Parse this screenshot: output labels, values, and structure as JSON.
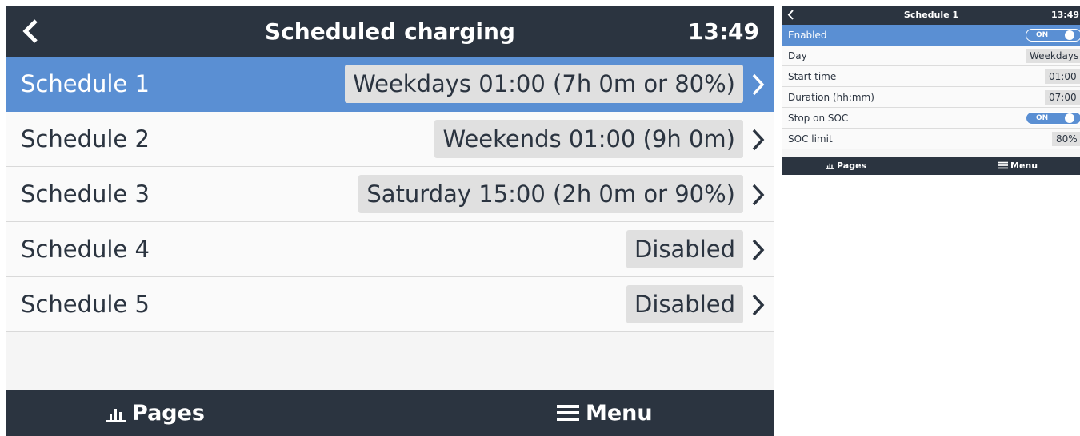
{
  "main": {
    "header": {
      "title": "Scheduled charging",
      "clock": "13:49",
      "back_icon": "chevron-left-icon"
    },
    "schedules": [
      {
        "name": "Schedule 1",
        "summary": "Weekdays 01:00 (7h 0m or 80%)",
        "selected": true
      },
      {
        "name": "Schedule 2",
        "summary": "Weekends 01:00 (9h 0m)",
        "selected": false
      },
      {
        "name": "Schedule 3",
        "summary": "Saturday 15:00 (2h 0m or 90%)",
        "selected": false
      },
      {
        "name": "Schedule 4",
        "summary": "Disabled",
        "selected": false
      },
      {
        "name": "Schedule 5",
        "summary": "Disabled",
        "selected": false
      }
    ],
    "footer": {
      "pages_label": "Pages",
      "menu_label": "Menu"
    }
  },
  "detail": {
    "header": {
      "title": "Schedule 1",
      "clock": "13:49",
      "back_icon": "chevron-left-icon"
    },
    "rows": [
      {
        "label": "Enabled",
        "type": "toggle",
        "value": "ON"
      },
      {
        "label": "Day",
        "type": "value",
        "value": "Weekdays"
      },
      {
        "label": "Start time",
        "type": "value",
        "value": "01:00"
      },
      {
        "label": "Duration (hh:mm)",
        "type": "value",
        "value": "07:00"
      },
      {
        "label": "Stop on SOC",
        "type": "toggle",
        "value": "ON"
      },
      {
        "label": "SOC limit",
        "type": "value",
        "value": "80%"
      }
    ],
    "footer": {
      "pages_label": "Pages",
      "menu_label": "Menu"
    }
  },
  "colors": {
    "header_bg": "#2b3440",
    "selected_bg": "#5a8fd3",
    "value_box_bg": "#e0e0e0",
    "row_bg": "#fafafa"
  }
}
